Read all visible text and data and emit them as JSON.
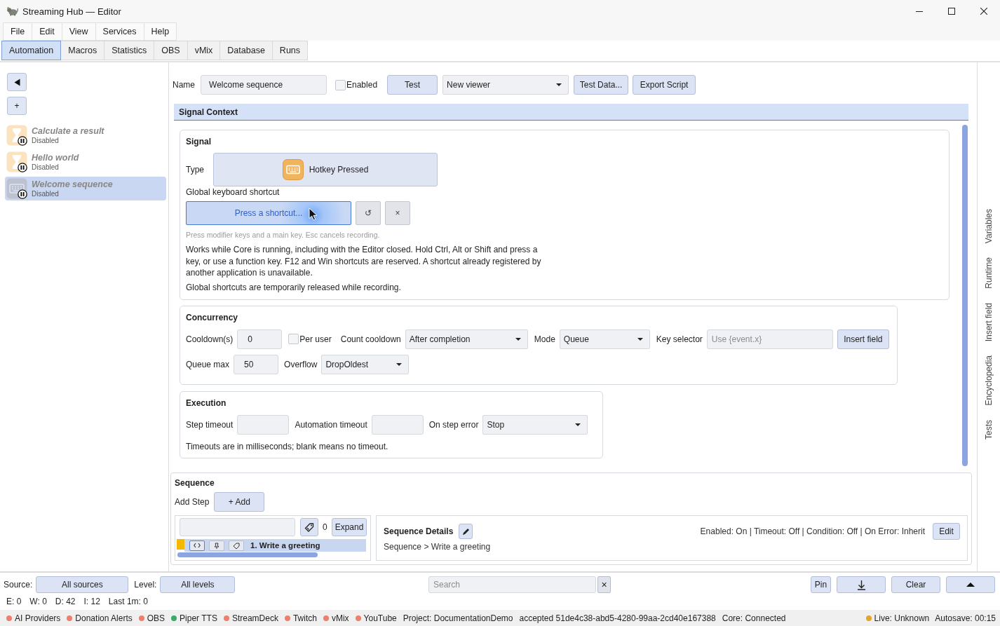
{
  "window": {
    "title": "Streaming Hub — Editor"
  },
  "menu": [
    "File",
    "Edit",
    "View",
    "Services",
    "Help"
  ],
  "tabs": [
    {
      "label": "Automation",
      "selected": true
    },
    {
      "label": "Macros",
      "selected": false
    },
    {
      "label": "Statistics",
      "selected": false
    },
    {
      "label": "OBS",
      "selected": false
    },
    {
      "label": "vMix",
      "selected": false
    },
    {
      "label": "Database",
      "selected": false
    },
    {
      "label": "Runs",
      "selected": false
    }
  ],
  "sidebar": {
    "add_button": "+",
    "items": [
      {
        "title": "Calculate a result",
        "status": "Disabled",
        "kind": "timer",
        "enabled": false,
        "selected": false
      },
      {
        "title": "Hello world",
        "status": "Disabled",
        "kind": "timer",
        "enabled": false,
        "selected": false
      },
      {
        "title": "Welcome sequence",
        "status": "Disabled",
        "kind": "hotkey",
        "enabled": false,
        "selected": true
      }
    ]
  },
  "editor": {
    "name": {
      "label": "Name",
      "value": "Welcome sequence"
    },
    "enabled": {
      "label": "Enabled",
      "checked": false
    },
    "test_button": "Test",
    "test_viewer": {
      "value": "New viewer"
    },
    "buttons": [
      "Test Data...",
      "Export Script"
    ]
  },
  "signal_context": {
    "title": "Signal Context",
    "signal": {
      "title": "Signal",
      "type_label": "Type",
      "type_value": "Hotkey Pressed",
      "shortcut_label": "Global keyboard shortcut",
      "shortcut_button": {
        "label": "Press a shortcut...",
        "recording": true
      },
      "reset_button": "↺",
      "clear_button": "×",
      "hint": "Press modifier keys and a main key. Esc cancels recording.",
      "description": "Works while Core is running, including with the Editor closed. Hold Ctrl, Alt or Shift and press a key, or use a function key. F12 and Win shortcuts are reserved. A shortcut already registered by another application is unavailable.",
      "note": "Global shortcuts are temporarily released while recording."
    },
    "concurrency": {
      "title": "Concurrency",
      "cooldown": {
        "label": "Cooldown(s)",
        "value": "0"
      },
      "per_user": {
        "label": "Per user",
        "checked": false
      },
      "count_cooldown": {
        "label": "Count cooldown",
        "value": "After completion"
      },
      "mode": {
        "label": "Mode",
        "value": "Queue"
      },
      "key_selector": {
        "label": "Key selector",
        "placeholder": "Use {event.x}"
      },
      "insert_field_button": "Insert field",
      "queue_max": {
        "label": "Queue max",
        "value": "50"
      },
      "overflow": {
        "label": "Overflow",
        "value": "DropOldest"
      }
    },
    "execution": {
      "title": "Execution",
      "step_timeout": {
        "label": "Step timeout"
      },
      "automation_timeout": {
        "label": "Automation timeout"
      },
      "on_step_error": {
        "label": "On step error",
        "value": "Stop"
      },
      "note": "Timeouts are in milliseconds; blank means no timeout."
    }
  },
  "sequence": {
    "title": "Sequence",
    "add_step_label": "Add Step",
    "add_button": "+ Add",
    "step_count": "0",
    "expand_button": "Expand",
    "steps": [
      {
        "label": "1. Write a greeting",
        "color": "#f5b800",
        "selected": true
      }
    ],
    "details": {
      "title": "Sequence Details",
      "breadcrumb": "Sequence > Write a greeting",
      "summary": "Enabled: On | Timeout: Off | Condition: Off | On Error: Inherit",
      "edit_button": "Edit"
    }
  },
  "log": {
    "source": {
      "label": "Source:",
      "value": "All sources"
    },
    "level": {
      "label": "Level:",
      "value": "All levels"
    },
    "search": {
      "placeholder": "Search"
    },
    "clear_search": "×",
    "pin_button": "Pin",
    "clear_button": "Clear",
    "stats": [
      "E: 0",
      "W: 0",
      "D: 42",
      "I: 12",
      "Last 1m: 0"
    ]
  },
  "status_bar": {
    "services": [
      {
        "name": "AI Providers",
        "color": "#ee7f6d"
      },
      {
        "name": "Donation Alerts",
        "color": "#ee7f6d"
      },
      {
        "name": "OBS",
        "color": "#ee7f6d"
      },
      {
        "name": "Piper TTS",
        "color": "#3caa6a"
      },
      {
        "name": "StreamDeck",
        "color": "#ee7f6d"
      },
      {
        "name": "Twitch",
        "color": "#ee7f6d"
      },
      {
        "name": "vMix",
        "color": "#ee7f6d"
      },
      {
        "name": "YouTube",
        "color": "#ee7f6d"
      }
    ],
    "project": "Project: DocumentationDemo",
    "message": "accepted 51de4c38-abd5-4280-99aa-2cd40e167388",
    "core": "Core: Connected",
    "live": {
      "label": "Live: Unknown",
      "color": "#e3a52a"
    },
    "autosave": "Autosave: 00:15"
  },
  "side_tabs": [
    "Variables",
    "Runtime",
    "Insert field",
    "Encyclopedia",
    "Tests"
  ]
}
